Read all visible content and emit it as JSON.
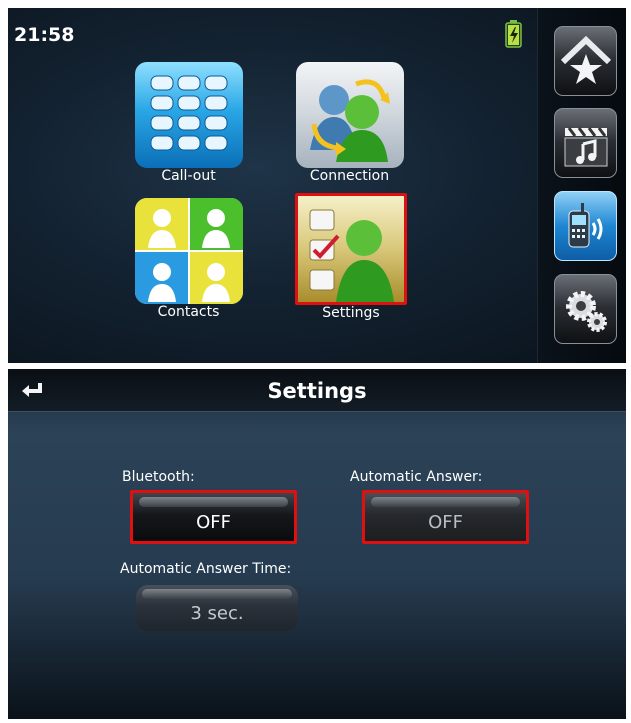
{
  "home": {
    "clock": "21:58",
    "apps": [
      {
        "label": "Call-out"
      },
      {
        "label": "Connection"
      },
      {
        "label": "Contacts"
      },
      {
        "label": "Settings"
      }
    ],
    "dock": [
      "home-star-icon",
      "media-clapper-music-icon",
      "phone-bluetooth-icon",
      "gears-icon"
    ],
    "accent_selected": "#e01010"
  },
  "settings": {
    "title": "Settings",
    "bluetooth_label": "Bluetooth:",
    "bluetooth_value": "OFF",
    "auto_answer_label": "Automatic Answer:",
    "auto_answer_value": "OFF",
    "auto_answer_time_label": "Automatic Answer Time:",
    "auto_answer_time_value": "3 sec."
  }
}
